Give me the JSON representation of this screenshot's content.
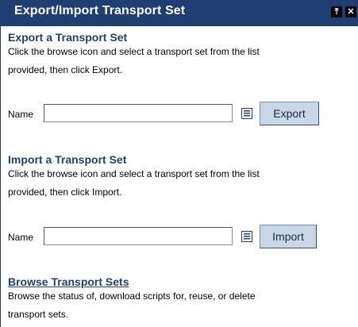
{
  "window": {
    "title": "Export/Import Transport Set"
  },
  "export": {
    "heading": "Export a Transport Set",
    "description_line1": "Click the browse icon and select a transport set from the list",
    "description_line2": "provided, then click Export.",
    "name_label": "Name",
    "name_value": "",
    "button_label": "Export"
  },
  "import": {
    "heading": "Import a Transport Set",
    "description_line1": "Click the browse icon and select a transport set from the list",
    "description_line2": "provided, then click Import.",
    "name_label": "Name",
    "name_value": "",
    "button_label": "Import"
  },
  "browse": {
    "heading": "Browse Transport Sets",
    "description_line1": "Browse the status of, download scripts for, reuse, or delete",
    "description_line2": "transport sets."
  },
  "colors": {
    "titlebar": "#1f3f73",
    "heading": "#1f3f73",
    "button": "#c9d6e6"
  },
  "icons": {
    "pin": "pin-icon",
    "close": "close-icon",
    "browse": "list-browse-icon"
  }
}
